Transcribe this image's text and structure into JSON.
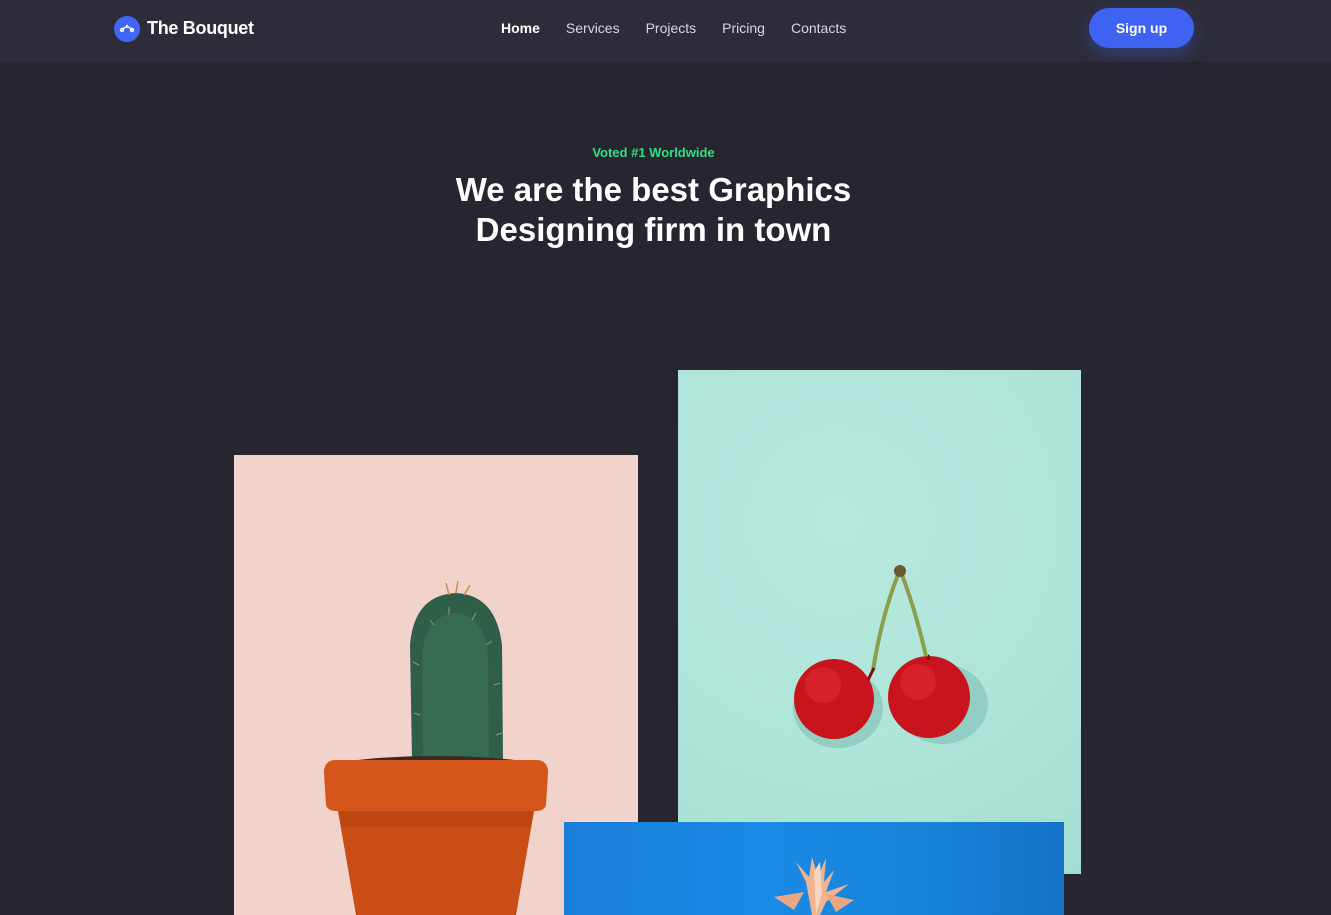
{
  "header": {
    "brand_name": "The Bouquet",
    "brand_icon": "bouquet-logo-icon",
    "nav": [
      {
        "label": "Home",
        "active": true
      },
      {
        "label": "Services",
        "active": false
      },
      {
        "label": "Projects",
        "active": false
      },
      {
        "label": "Pricing",
        "active": false
      },
      {
        "label": "Contacts",
        "active": false
      }
    ],
    "signup_label": "Sign up"
  },
  "hero": {
    "eyebrow": "Voted #1 Worldwide",
    "headline_line1": "We are the best Graphics",
    "headline_line2": "Designing firm in town"
  },
  "gallery": [
    {
      "subject": "potted cactus",
      "background": "#f2d3cc"
    },
    {
      "subject": "cherries",
      "background": "#aee4d8"
    },
    {
      "subject": "pineapple",
      "background": "#1a84dc"
    }
  ],
  "colors": {
    "page_bg": "#262530",
    "nav_bg": "#2d2c39",
    "accent": "#3e63f3",
    "eyebrow": "#2ee07f"
  }
}
